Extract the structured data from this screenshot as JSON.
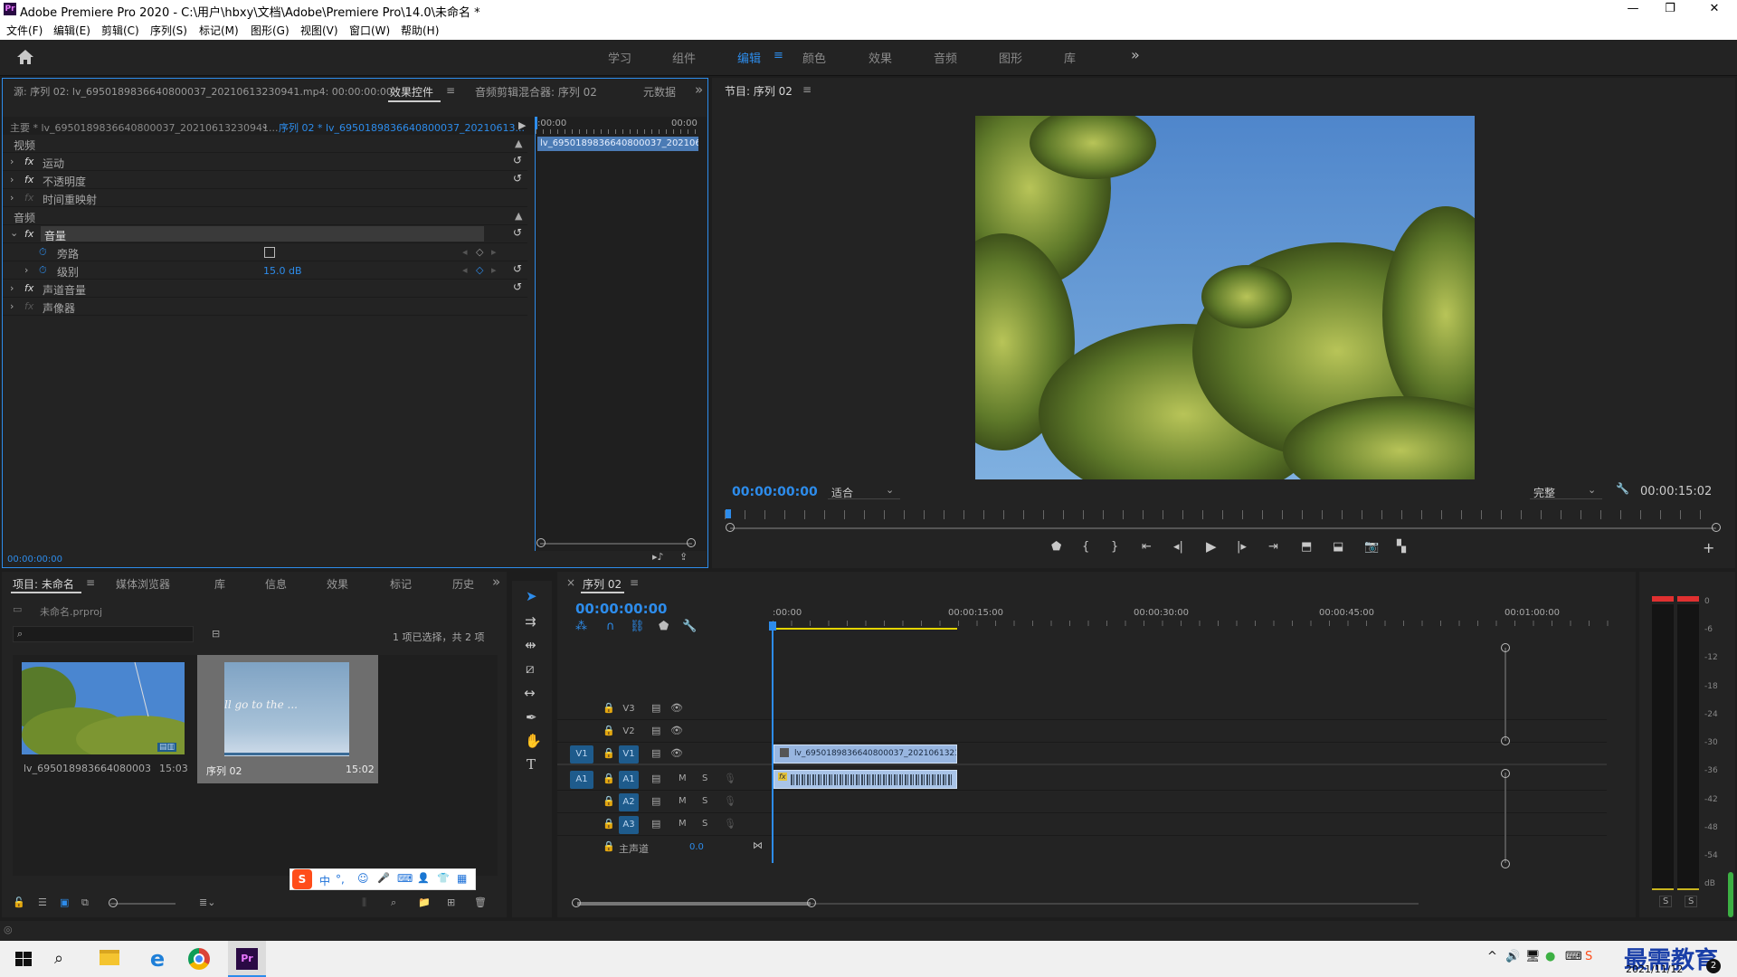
{
  "titlebar": {
    "app_icon": "Pr",
    "title": "Adobe Premiere Pro 2020 - C:\\用户\\hbxy\\文档\\Adobe\\Premiere Pro\\14.0\\未命名 *",
    "min_glyph": "—",
    "max_glyph": "❐",
    "close_glyph": "✕"
  },
  "menubar": {
    "items": [
      "文件(F)",
      "编辑(E)",
      "剪辑(C)",
      "序列(S)",
      "标记(M)",
      "图形(G)",
      "视图(V)",
      "窗口(W)",
      "帮助(H)"
    ]
  },
  "workspaces": {
    "items": [
      "学习",
      "组件",
      "编辑",
      "颜色",
      "效果",
      "音频",
      "图形",
      "库"
    ],
    "active": "编辑",
    "more": "»",
    "menu_glyph": "≡"
  },
  "source_panel": {
    "tabs": [
      "源: 序列 02: lv_6950189836640800037_20210613230941.mp4: 00:00:00:00",
      "效果控件",
      "音频剪辑混合器: 序列 02",
      "元数据"
    ],
    "active_tab": "效果控件",
    "tab_menu": "≡",
    "more": "»",
    "master_label": "主要 * lv_6950189836640800037_20210613230941...",
    "seq_label": "序列 02 * lv_6950189836640800037_20210613...",
    "tl_start": ":00:00",
    "tl_end": "00:00",
    "clip_name": "lv_6950189836640800037_2021061",
    "section_video": "视频",
    "section_audio": "音频",
    "fx_glyph": "fx",
    "video_effects": [
      "运动",
      "不透明度",
      "时间重映射"
    ],
    "audio_effects": [
      "音量",
      "声道音量",
      "声像器"
    ],
    "volume_props": [
      "旁路",
      "级别"
    ],
    "level_value": "15.0 dB",
    "timecode": "00:00:00:00"
  },
  "program_panel": {
    "title": "节目: 序列 02",
    "title_menu": "≡",
    "timecode": "00:00:00:00",
    "fit_label": "适合",
    "quality_label": "完整",
    "duration": "00:00:15:02",
    "add_glyph": "+"
  },
  "project_panel": {
    "tabs": [
      "项目: 未命名",
      "媒体浏览器",
      "库",
      "信息",
      "效果",
      "标记",
      "历史"
    ],
    "active_tab": "项目: 未命名",
    "tab_menu": "≡",
    "more": "»",
    "project_file": "未命名.prproj",
    "selection_info": "1 项已选择，共 2 项",
    "search_placeholder": "",
    "items": [
      {
        "name": "lv_6950189836640800037_...",
        "duration": "15:03",
        "badge": "▤▥"
      },
      {
        "name": "序列 02",
        "duration": "15:02",
        "overlay_text": "ll go to the ..."
      }
    ]
  },
  "ime_toolbar": {
    "logo": "S",
    "mode": "中",
    "punct": "°,",
    "items": [
      "☺",
      "🎤",
      "⌨",
      "👤",
      "👕",
      "▦"
    ]
  },
  "timeline_panel": {
    "close_glyph": "×",
    "title": "序列 02",
    "title_menu": "≡",
    "timecode": "00:00:00:00",
    "ruler": [
      ":00:00",
      "00:00:15:00",
      "00:00:30:00",
      "00:00:45:00",
      "00:01:00:00"
    ],
    "video_tracks": [
      "V3",
      "V2",
      "V1"
    ],
    "audio_tracks": [
      "A1",
      "A2",
      "A3"
    ],
    "source_v": "V1",
    "source_a": "A1",
    "mute": "M",
    "solo": "S",
    "master_label": "主声道",
    "master_value": "0.0",
    "video_clip": "lv_6950189836640800037_20210613230",
    "audio_clip_fx": "fx"
  },
  "meter": {
    "scale": [
      "0",
      "-6",
      "-12",
      "-18",
      "-24",
      "-30",
      "-36",
      "-42",
      "-48",
      "-54",
      "dB"
    ],
    "solo_left": "S",
    "solo_right": "S"
  },
  "taskbar": {
    "clock_date": "2021/11/12",
    "watermark": "最需教育",
    "badge": "2"
  },
  "colors": {
    "accent": "#2d8ceb",
    "playhead": "#2d8ceb",
    "meter_peak": "#e03030",
    "work_area": "#e3d400",
    "clip_video": "#98b6e0",
    "clip_audio": "#a9c4e8"
  }
}
